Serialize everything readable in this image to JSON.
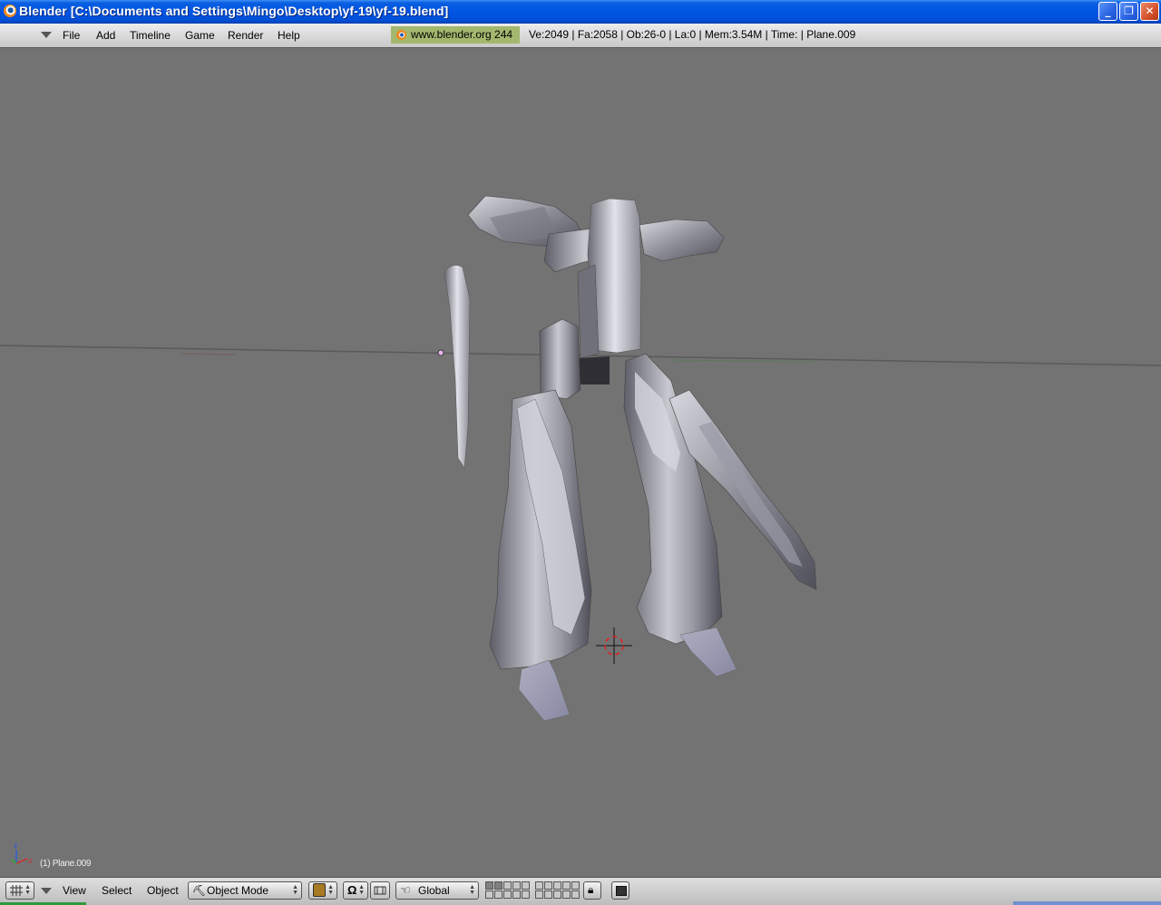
{
  "window": {
    "title": "Blender [C:\\Documents and Settings\\Mingo\\Desktop\\yf-19\\yf-19.blend]",
    "buttons": {
      "minimize": "minimize-icon",
      "restore": "restore-icon",
      "close": "close-icon"
    }
  },
  "top_menu": {
    "items": [
      "File",
      "Add",
      "Timeline",
      "Game",
      "Render",
      "Help"
    ],
    "website": "www.blender.org 244",
    "stats": "Ve:2049 | Fa:2058 | Ob:26-0 | La:0  | Mem:3.54M  | Time: | Plane.009"
  },
  "viewport": {
    "object_label": "(1) Plane.009",
    "axis_labels": {
      "z": "z",
      "x": "x"
    },
    "background_color": "#737373"
  },
  "bottom_bar": {
    "menu_items": [
      "View",
      "Select",
      "Object"
    ],
    "mode": "Object Mode",
    "orientation": "Global",
    "icons": [
      "viewport-grid-icon",
      "draw-type-icon",
      "pivot-icon",
      "manipulator-icon",
      "hand-icon",
      "lock-icon",
      "render-icon"
    ]
  }
}
